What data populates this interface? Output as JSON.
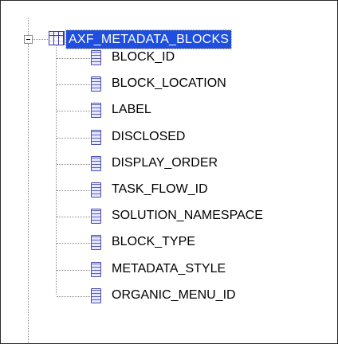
{
  "tree": {
    "root": {
      "label": "AXF_METADATA_BLOCKS",
      "expanded": true,
      "icon": "table-icon"
    },
    "columns": [
      {
        "label": "BLOCK_ID",
        "icon": "column-icon"
      },
      {
        "label": "BLOCK_LOCATION",
        "icon": "column-icon"
      },
      {
        "label": "LABEL",
        "icon": "column-icon"
      },
      {
        "label": "DISCLOSED",
        "icon": "column-icon"
      },
      {
        "label": "DISPLAY_ORDER",
        "icon": "column-icon"
      },
      {
        "label": "TASK_FLOW_ID",
        "icon": "column-icon"
      },
      {
        "label": "SOLUTION_NAMESPACE",
        "icon": "column-icon"
      },
      {
        "label": "BLOCK_TYPE",
        "icon": "column-icon"
      },
      {
        "label": "METADATA_STYLE",
        "icon": "column-icon"
      },
      {
        "label": "ORGANIC_MENU_ID",
        "icon": "column-icon"
      }
    ]
  },
  "colors": {
    "selection": "#1e4fe0",
    "focus_outline": "#e0a000"
  }
}
